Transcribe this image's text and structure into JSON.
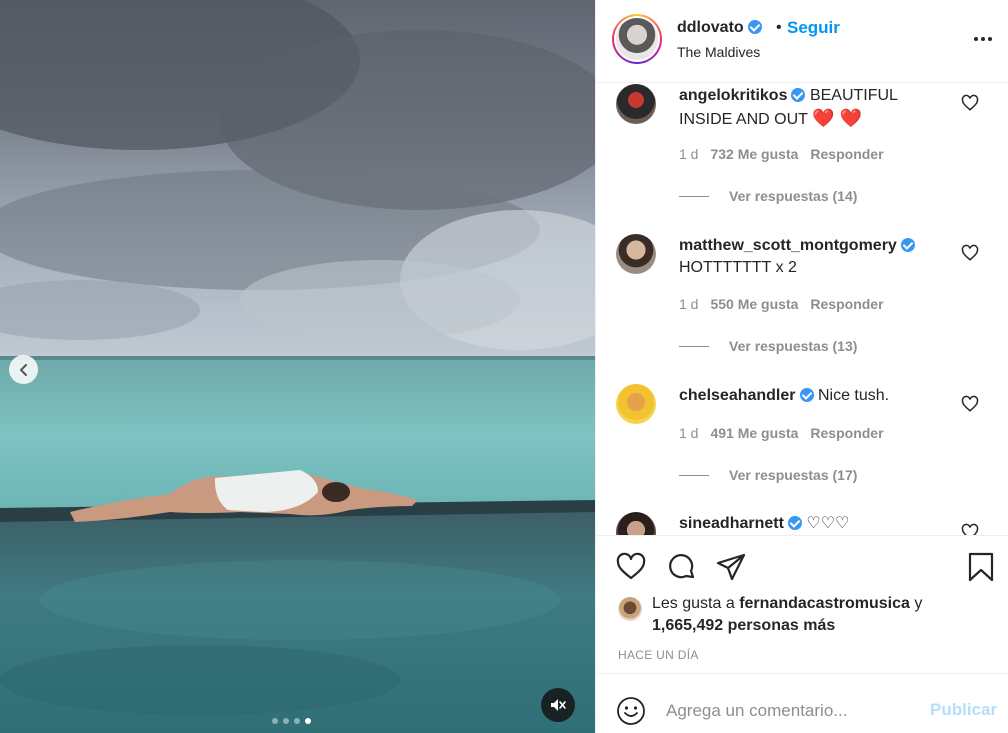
{
  "post": {
    "username": "ddlovato",
    "bullet": "•",
    "follow_label": "Seguir",
    "location": "The Maldives"
  },
  "media": {
    "carousel_total": 4,
    "carousel_active": 4
  },
  "comments": [
    {
      "username": "angelokritikos",
      "verified": true,
      "text": "BEAUTIFUL INSIDE AND OUT",
      "emoji": "❤️ ❤️",
      "age": "1 d",
      "likes": "732 Me gusta",
      "reply_label": "Responder",
      "view_replies": "Ver respuestas (14)"
    },
    {
      "username": "matthew_scott_montgomery",
      "verified": true,
      "text": "HOTTTTTTT x 2",
      "age": "1 d",
      "likes": "550 Me gusta",
      "reply_label": "Responder",
      "view_replies": "Ver respuestas (13)"
    },
    {
      "username": "chelseahandler",
      "verified": true,
      "text": "Nice tush.",
      "age": "1 d",
      "likes": "491 Me gusta",
      "reply_label": "Responder",
      "view_replies": "Ver respuestas (17)"
    },
    {
      "username": "sineadharnett",
      "verified": true,
      "text": "♡♡♡"
    }
  ],
  "likes": {
    "prefix": "Les gusta a",
    "user": "fernandacastromusica",
    "connector": "y",
    "others": "1,665,492 personas más"
  },
  "timestamp": "HACE UN DÍA",
  "add_comment": {
    "placeholder": "Agrega un comentario...",
    "post_label": "Publicar"
  },
  "icons": {
    "prev": "chevron-left-icon",
    "mute": "speaker-muted-icon",
    "like": "heart-icon",
    "comment": "speech-bubble-icon",
    "share": "paper-plane-icon",
    "save": "bookmark-icon",
    "emoji": "smiley-icon",
    "more": "ellipsis-icon"
  },
  "colors": {
    "accent": "#0095f6",
    "verified": "#3897f0",
    "post_disabled": "#b2dffc",
    "muted_text": "#8e8e8e"
  }
}
